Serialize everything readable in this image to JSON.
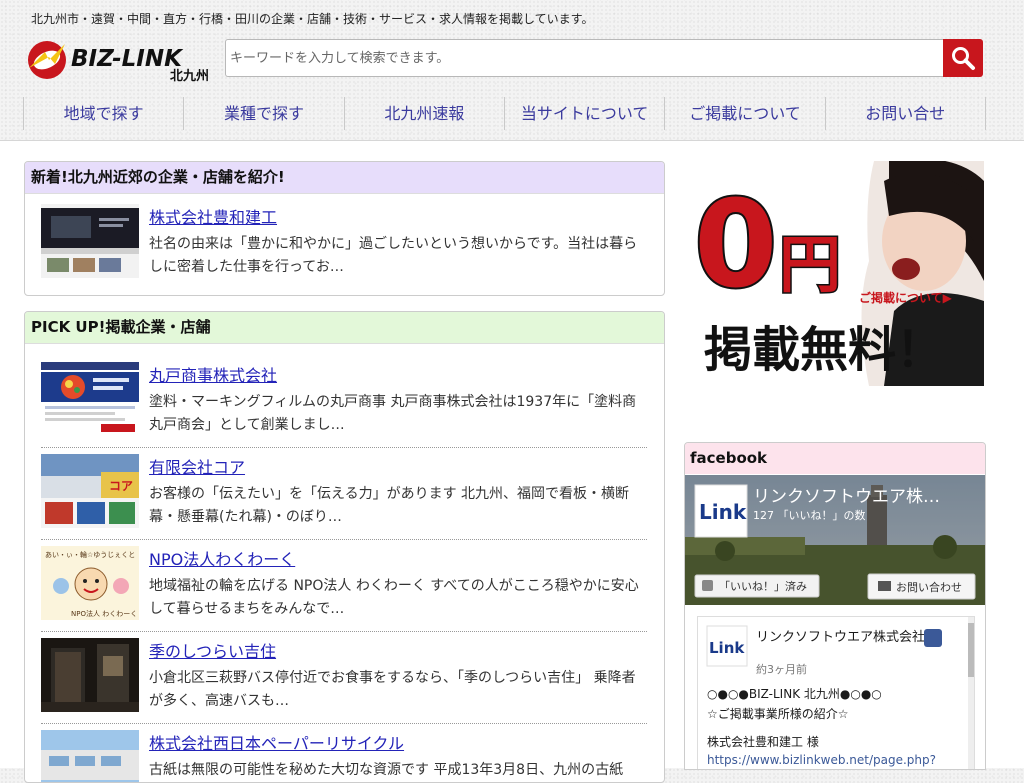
{
  "header": {
    "tagline": "北九州市・遠賀・中間・直方・行橋・田川の企業・店舗・技術・サービス・求人情報を掲載しています。",
    "logo_text": "BIZ-LINK",
    "logo_sub": "北九州",
    "search_placeholder": "キーワードを入力して検索できます。"
  },
  "nav": [
    {
      "label": "地域で探す"
    },
    {
      "label": "業種で探す"
    },
    {
      "label": "北九州速報"
    },
    {
      "label": "当サイトについて"
    },
    {
      "label": "ご掲載について"
    },
    {
      "label": "お問い合せ"
    }
  ],
  "new_section": {
    "heading": "新着!北九州近郊の企業・店舗を紹介!",
    "items": [
      {
        "title": "株式会社豊和建工",
        "desc": "社名の由来は「豊かに和やかに」過ごしたいという想いからです。当社は暮らしに密着した仕事を行ってお…"
      }
    ]
  },
  "pickup_section": {
    "heading": "PICK UP!掲載企業・店舗",
    "items": [
      {
        "title": "丸戸商事株式会社",
        "desc": "塗料・マーキングフィルムの丸戸商事 丸戸商事株式会社は1937年に「塗料商丸戸商会」として創業しまし…"
      },
      {
        "title": "有限会社コア",
        "desc": "お客様の「伝えたい」を「伝える力」があります 北九州、福岡で看板・横断幕・懸垂幕(たれ幕)・のぼり…"
      },
      {
        "title": "NPO法人わくわーく",
        "desc": "地域福祉の輪を広げる NPO法人 わくわーく すべての人がこころ穏やかに安心して暮らせるまちをみんなで…"
      },
      {
        "title": "季のしつらい吉住",
        "desc": "小倉北区三萩野バス停付近でお食事をするなら、「季のしつらい吉住」 乗降者が多く、高速バスも…"
      },
      {
        "title": "株式会社西日本ペーパーリサイクル",
        "desc": "古紙は無限の可能性を秘めた大切な資源です 平成13年3月8日、九州の古紙"
      }
    ],
    "thumb_texts": {
      "npo_top": "あい・ぃ・輪☆ゆうじぇくと",
      "npo_bottom": "NPO法人 わくわーく",
      "core_sign": "コア"
    }
  },
  "banner": {
    "big_zero": "0",
    "yen": "円",
    "link": "ご掲載について▶",
    "free": "掲載無料！"
  },
  "facebook": {
    "heading": "facebook",
    "page_name": "リンクソフトウエア株…",
    "likes": "127 「いいね！」の数",
    "liked_btn": "「いいね！」済み",
    "contact_btn": "お問い合わせ",
    "logo_text": "Link",
    "post_author": "リンクソフトウエア株式会社",
    "post_time": "約3ヶ月前",
    "post_line1": "○●○●BIZ-LINK 北九州●○●○",
    "post_line2": "☆ご掲載事業所様の紹介☆",
    "post_line3": "株式会社豊和建工 様",
    "post_link": "https://www.bizlinkweb.net/page.php?"
  },
  "colors": {
    "accent_red": "#c8161d",
    "link_blue": "#2323b8",
    "nav_text": "#3b3b9e",
    "new_head_bg": "#e7ddfb",
    "pickup_head_bg": "#e3f8d9",
    "fb_head_bg": "#fde3ec"
  }
}
